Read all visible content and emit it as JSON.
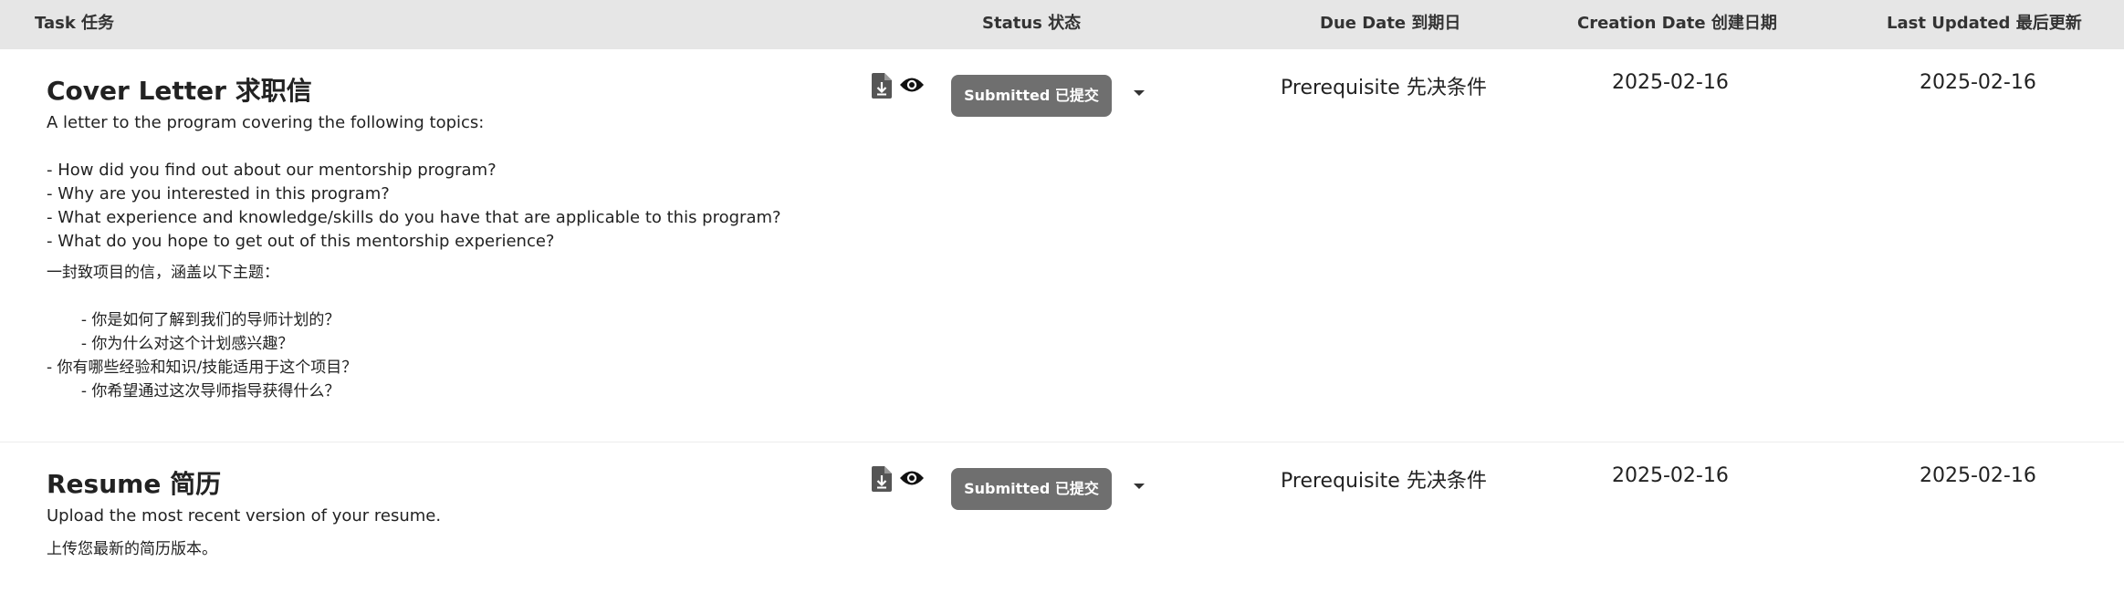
{
  "header": {
    "task": "Task  任务",
    "status": "Status  状态",
    "due_date": "Due Date  到期日",
    "creation_date": "Creation Date  创建日期",
    "last_updated": "Last Updated  最后更新"
  },
  "rows": [
    {
      "title": "Cover Letter  求职信",
      "description_en": "A letter to the program covering the following topics:\n\n- How did you find out about our mentorship program?\n- Why are you interested in this program?\n- What experience and knowledge/skills do you have that are applicable to this program?\n- What do you hope to get out of this mentorship experience?",
      "description_zh": "一封致项目的信，涵盖以下主题：\n\n       - 你是如何了解到我们的导师计划的？\n       - 你为什么对这个计划感兴趣？\n- 你有哪些经验和知识/技能适用于这个项目？\n       - 你希望通过这次导师指导获得什么？",
      "status": "Submitted  已提交",
      "due_date": "Prerequisite  先决条件",
      "creation_date": "2025-02-16",
      "last_updated": "2025-02-16",
      "icons": [
        "download-document-icon",
        "eye-icon"
      ]
    },
    {
      "title": "Resume  简历",
      "description_en": "Upload the most recent version of your resume.",
      "description_zh": "上传您最新的简历版本。",
      "status": "Submitted  已提交",
      "due_date": "Prerequisite  先决条件",
      "creation_date": "2025-02-16",
      "last_updated": "2025-02-16",
      "icons": [
        "download-document-icon",
        "eye-icon"
      ]
    }
  ],
  "colors": {
    "header_bg": "#e6e6e6",
    "status_bg": "#6f6f6f",
    "status_text": "#ffffff"
  }
}
